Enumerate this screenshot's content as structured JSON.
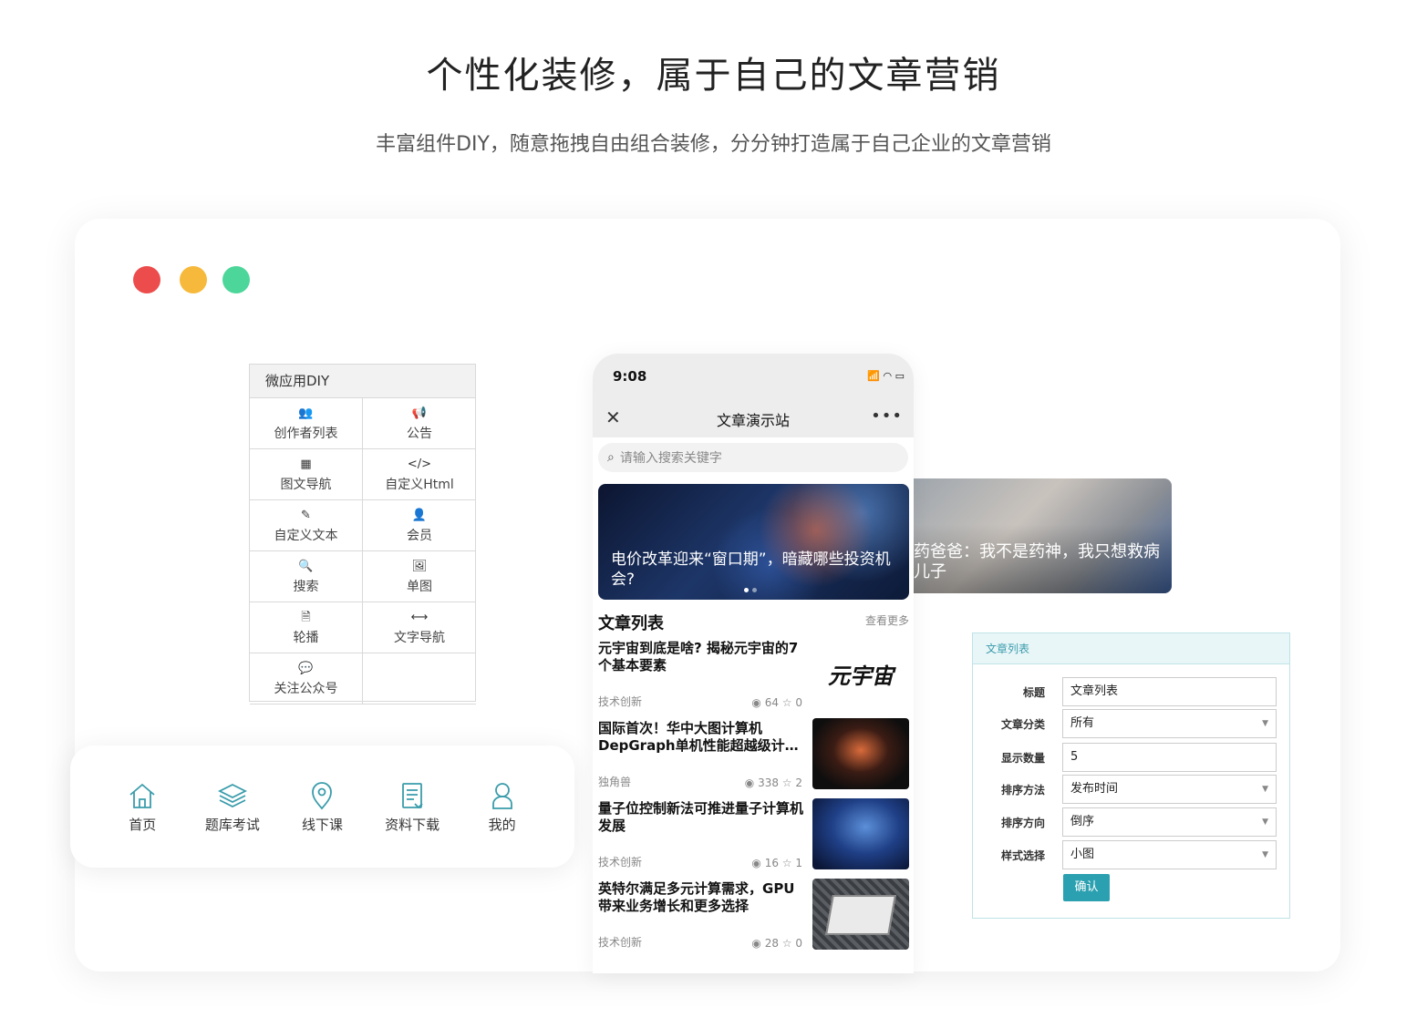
{
  "hero": {
    "title": "个性化装修，属于自己的文章营销",
    "subtitle": "丰富组件DIY，随意拖拽自由组合装修，分分钟打造属于自己企业的文章营销"
  },
  "window_dots": {
    "colors": [
      "#ec4c4c",
      "#f6b93b",
      "#4dd69a"
    ]
  },
  "diy_panel": {
    "title": "微应用DIY",
    "items": [
      {
        "icon": "users-icon",
        "glyph": "👥",
        "label": "创作者列表"
      },
      {
        "icon": "megaphone-icon",
        "glyph": "📢",
        "label": "公告"
      },
      {
        "icon": "grid-icon",
        "glyph": "▦",
        "label": "图文导航"
      },
      {
        "icon": "code-icon",
        "glyph": "</>",
        "label": "自定义Html"
      },
      {
        "icon": "edit-icon",
        "glyph": "✎",
        "label": "自定义文本"
      },
      {
        "icon": "user-plus-icon",
        "glyph": "👤",
        "label": "会员"
      },
      {
        "icon": "search-icon",
        "glyph": "🔍",
        "label": "搜索"
      },
      {
        "icon": "image-icon",
        "glyph": "🖼",
        "label": "单图"
      },
      {
        "icon": "slides-icon",
        "glyph": "🗎",
        "label": "轮播"
      },
      {
        "icon": "arrows-h-icon",
        "glyph": "⟷",
        "label": "文字导航"
      },
      {
        "icon": "wechat-icon",
        "glyph": "💬",
        "label": "关注公众号"
      }
    ]
  },
  "tabbar": {
    "accent": "#3a9cab",
    "items": [
      {
        "icon": "home-icon",
        "label": "首页"
      },
      {
        "icon": "layers-icon",
        "label": "题库考试"
      },
      {
        "icon": "location-icon",
        "label": "线下课"
      },
      {
        "icon": "document-icon",
        "label": "资料下载"
      },
      {
        "icon": "user-icon",
        "label": "我的"
      }
    ]
  },
  "phone": {
    "time": "9:08",
    "signal": "📶 ◠ ▭",
    "close_glyph": "✕",
    "title": "文章演示站",
    "more_glyph": "•••",
    "search_placeholder": "请输入搜索关键字",
    "banner_caption": "电价改革迎来“窗口期”，暗藏哪些投资机会?",
    "list_title": "文章列表",
    "list_more": "查看更多",
    "articles": [
      {
        "title": "元宇宙到底是啥? 揭秘元宇宙的7个基本要素",
        "category": "技术创新",
        "views": "64",
        "stars": "0",
        "thumb_text": "元宇宙"
      },
      {
        "title": "国际首次！华中大图计算机DepGraph单机性能超越级计…",
        "category": "独角兽",
        "views": "338",
        "stars": "2",
        "thumb_text": ""
      },
      {
        "title": "量子位控制新法可推进量子计算机发展",
        "category": "技术创新",
        "views": "16",
        "stars": "1",
        "thumb_text": ""
      },
      {
        "title": "英特尔满足多元计算需求，GPU带来业务增长和更多选择",
        "category": "技术创新",
        "views": "28",
        "stars": "0",
        "thumb_text": ""
      }
    ]
  },
  "side_photo": {
    "caption": "药爸爸：我不是药神，我只想救病儿子"
  },
  "form": {
    "header": "文章列表",
    "fields": [
      {
        "label": "标题",
        "value": "文章列表",
        "select": false
      },
      {
        "label": "文章分类",
        "value": "所有",
        "select": true
      },
      {
        "label": "显示数量",
        "value": "5",
        "select": false
      },
      {
        "label": "排序方法",
        "value": "发布时间",
        "select": true
      },
      {
        "label": "排序方向",
        "value": "倒序",
        "select": true
      },
      {
        "label": "样式选择",
        "value": "小图",
        "select": true
      }
    ],
    "confirm": "确认",
    "accent": "#2ba0b0"
  }
}
